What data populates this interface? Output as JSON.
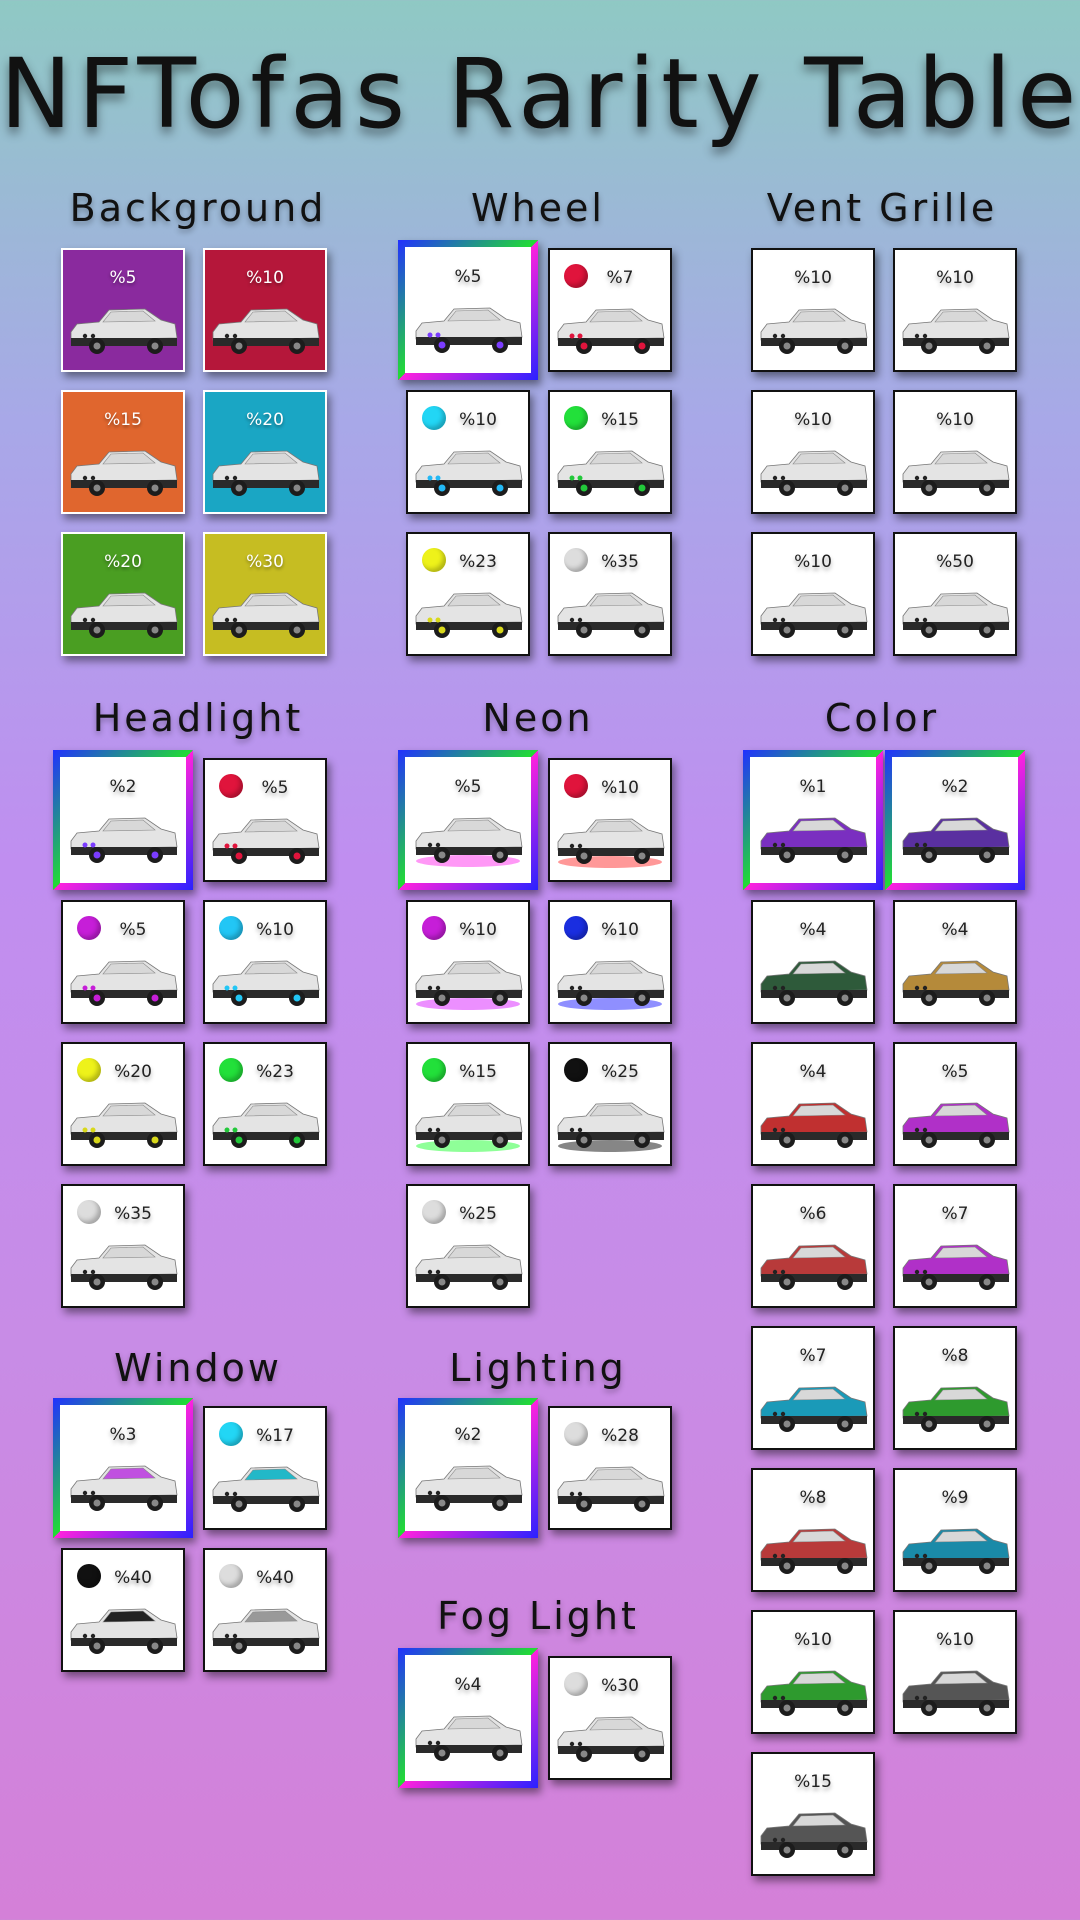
{
  "title": "NFTofas Rarity Table",
  "sections": {
    "background": {
      "label": "Background",
      "items": [
        {
          "pct": "%5",
          "tile": "#8a2a9e"
        },
        {
          "pct": "%10",
          "tile": "#b5173a"
        },
        {
          "pct": "%15",
          "tile": "#e0662e"
        },
        {
          "pct": "%20",
          "tile": "#1aa6c4"
        },
        {
          "pct": "%20",
          "tile": "#4a9e22"
        },
        {
          "pct": "%30",
          "tile": "#c6bd22"
        }
      ]
    },
    "wheel": {
      "label": "Wheel",
      "items": [
        {
          "pct": "%5",
          "rare": true,
          "accent": "#7b3cff"
        },
        {
          "pct": "%7",
          "dot": "#e0143c",
          "accent": "#e0143c"
        },
        {
          "pct": "%10",
          "dot": "#22d6f5",
          "accent": "#22b8f5"
        },
        {
          "pct": "%15",
          "dot": "#22e03a",
          "accent": "#22c83a"
        },
        {
          "pct": "%23",
          "dot": "#eef21a",
          "accent": "#d8d81a"
        },
        {
          "pct": "%35",
          "dot": "#dddddd"
        }
      ]
    },
    "vent_grille": {
      "label": "Vent Grille",
      "items": [
        {
          "pct": "%10"
        },
        {
          "pct": "%10"
        },
        {
          "pct": "%10"
        },
        {
          "pct": "%10"
        },
        {
          "pct": "%10"
        },
        {
          "pct": "%50"
        }
      ]
    },
    "headlight": {
      "label": "Headlight",
      "items": [
        {
          "pct": "%2",
          "rare": true,
          "accent": "#7b3cff"
        },
        {
          "pct": "%5",
          "dot": "#e0143c",
          "accent": "#e0143c"
        },
        {
          "pct": "%5",
          "dot": "#c61ed8",
          "accent": "#c61ed8"
        },
        {
          "pct": "%10",
          "dot": "#22c6f5",
          "accent": "#22c6f5"
        },
        {
          "pct": "%20",
          "dot": "#eef21a",
          "accent": "#d8d81a"
        },
        {
          "pct": "%23",
          "dot": "#22e03a",
          "accent": "#22c83a"
        },
        {
          "pct": "%35",
          "dot": "#dddddd"
        }
      ]
    },
    "neon": {
      "label": "Neon",
      "items": [
        {
          "pct": "%5",
          "rare": true,
          "glow": "#ff44ee"
        },
        {
          "pct": "%10",
          "dot": "#e0143c",
          "glow": "#ff4444"
        },
        {
          "pct": "%10",
          "dot": "#c61ed8",
          "glow": "#dd33ff"
        },
        {
          "pct": "%10",
          "dot": "#1a2ee0",
          "glow": "#3333ff"
        },
        {
          "pct": "%15",
          "dot": "#22e03a",
          "glow": "#33ff44"
        },
        {
          "pct": "%25",
          "dot": "#111111",
          "glow": "#222222"
        },
        {
          "pct": "%25",
          "dot": "#dddddd"
        }
      ]
    },
    "color": {
      "label": "Color",
      "items": [
        {
          "pct": "%1",
          "rare": true,
          "body": "#7a2fc0"
        },
        {
          "pct": "%2",
          "rare": true,
          "body": "#5a30a0"
        },
        {
          "pct": "%4",
          "body": "#2e5a3a"
        },
        {
          "pct": "%4",
          "body": "#b58a3a"
        },
        {
          "pct": "%4",
          "body": "#c03030"
        },
        {
          "pct": "%5",
          "body": "#b030c8"
        },
        {
          "pct": "%6",
          "body": "#b83a3a"
        },
        {
          "pct": "%7",
          "body": "#b030c8"
        },
        {
          "pct": "%7",
          "body": "#1a9ab8"
        },
        {
          "pct": "%8",
          "body": "#2e9a2e"
        },
        {
          "pct": "%8",
          "body": "#b83a3a"
        },
        {
          "pct": "%9",
          "body": "#1a8aa8"
        },
        {
          "pct": "%10",
          "body": "#2e9a2e"
        },
        {
          "pct": "%10",
          "body": "#555555"
        },
        {
          "pct": "%15",
          "body": "#555555"
        }
      ]
    },
    "window": {
      "label": "Window",
      "items": [
        {
          "pct": "%3",
          "rare": true,
          "glass": "#c050e0"
        },
        {
          "pct": "%17",
          "dot": "#22d6f5",
          "glass": "#22b8c8"
        },
        {
          "pct": "%40",
          "dot": "#111111",
          "glass": "#222222"
        },
        {
          "pct": "%40",
          "dot": "#dddddd",
          "glass": "#999999"
        }
      ]
    },
    "lighting": {
      "label": "Lighting",
      "items": [
        {
          "pct": "%2",
          "rare": true
        },
        {
          "pct": "%28",
          "dot": "#dddddd"
        }
      ]
    },
    "fog_light": {
      "label": "Fog Light",
      "items": [
        {
          "pct": "%4",
          "rare": true
        },
        {
          "pct": "%30",
          "dot": "#dddddd"
        }
      ]
    }
  }
}
